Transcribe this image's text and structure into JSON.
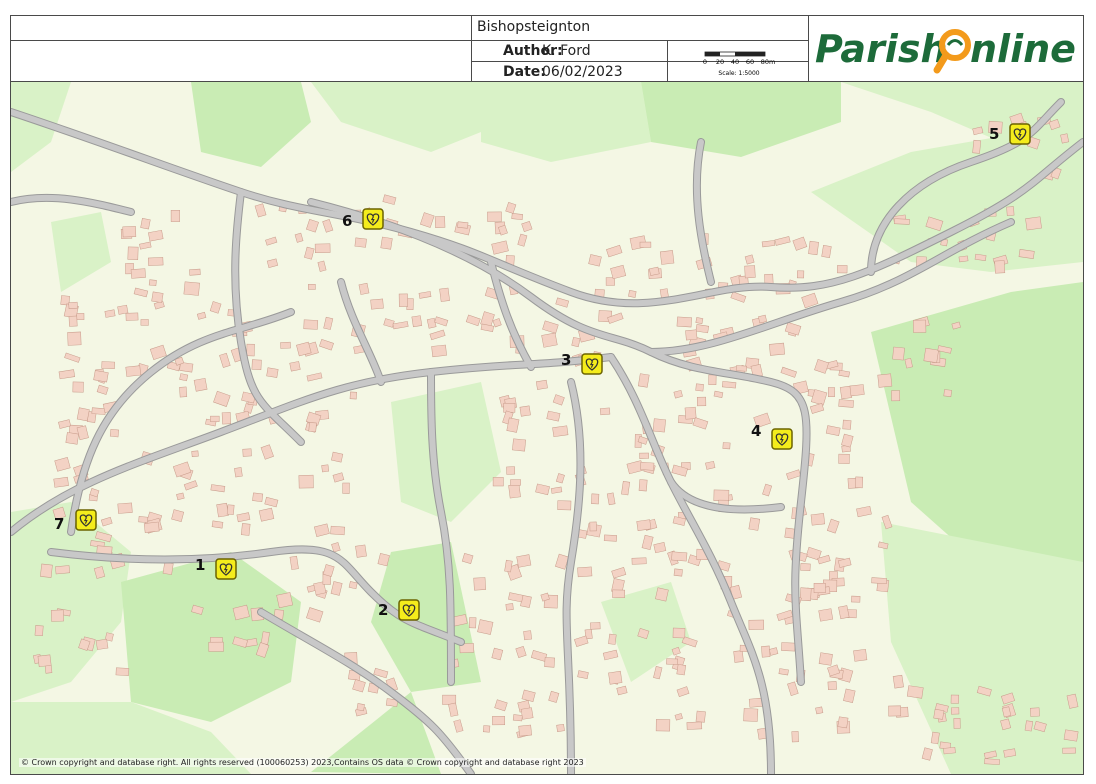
{
  "header": {
    "parish": "Bishopsteignton",
    "author_label": "Author:",
    "author": "K. Ford",
    "date_label": "Date:",
    "date": "06/02/2023",
    "scale_ticks": [
      "0",
      "20",
      "40",
      "60",
      "80m"
    ],
    "scale_text": "Scale: 1:5000",
    "logo_text_left": "Parish",
    "logo_text_right": "nline"
  },
  "map": {
    "colors": {
      "background": "#f4f7e4",
      "field": "#d9f2c7",
      "woodland": "#c9ecb4",
      "building": "#f3d2c4",
      "building_edge": "#c79b8a",
      "road": "#c8c8c8",
      "road_edge": "#9a9a9a",
      "marker": "#f4ec1c",
      "marker_edge": "#6b6300"
    },
    "markers": [
      {
        "label": "1",
        "icon": "defibrillator-icon"
      },
      {
        "label": "2",
        "icon": "defibrillator-icon"
      },
      {
        "label": "3",
        "icon": "defibrillator-icon"
      },
      {
        "label": "4",
        "icon": "defibrillator-icon"
      },
      {
        "label": "5",
        "icon": "defibrillator-icon"
      },
      {
        "label": "6",
        "icon": "defibrillator-icon"
      },
      {
        "label": "7",
        "icon": "defibrillator-icon"
      }
    ],
    "copyright": "© Crown copyright and database right. All rights reserved (100060253) 2023,Contains OS data © Crown copyright and database right 2023"
  }
}
